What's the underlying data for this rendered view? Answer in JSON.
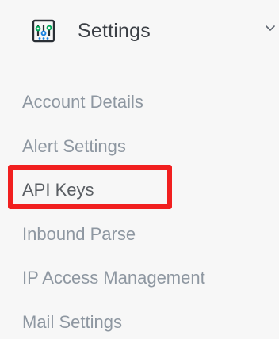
{
  "section": {
    "title": "Settings",
    "icon": "settings-sliders-icon",
    "expand_icon": "chevron-down-icon"
  },
  "submenu": {
    "items": [
      {
        "label": "Account Details"
      },
      {
        "label": "Alert Settings"
      },
      {
        "label": "API Keys"
      },
      {
        "label": "Inbound Parse"
      },
      {
        "label": "IP Access Management"
      },
      {
        "label": "Mail Settings"
      }
    ]
  },
  "highlight": {
    "target": "API Keys",
    "color": "#f11f1f"
  },
  "colors": {
    "background": "#f7f7f7",
    "header_text": "#3b3f45",
    "submenu_text": "#8e97a1",
    "active_text": "#5a5e63",
    "icon": "#2a2f35"
  }
}
